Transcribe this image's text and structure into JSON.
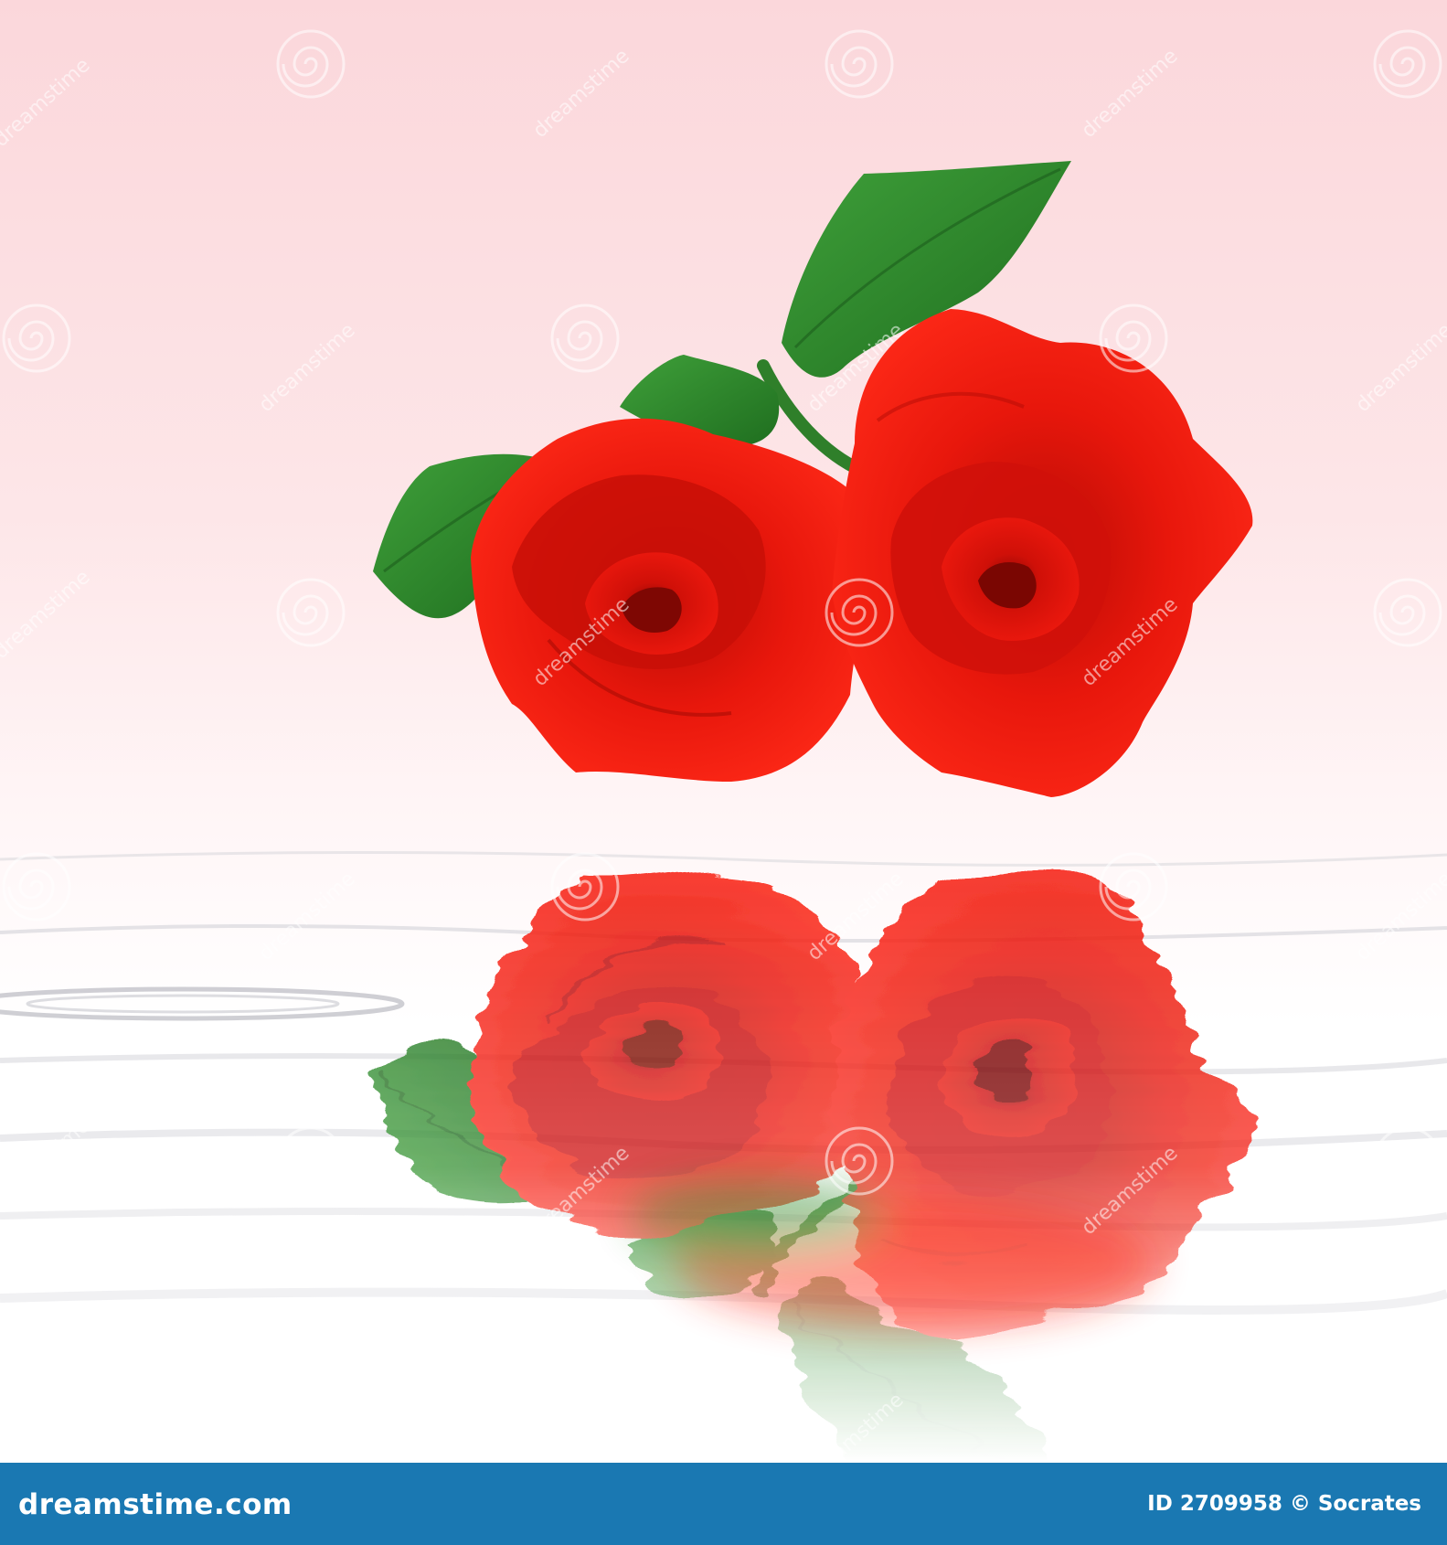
{
  "footer": {
    "brand": "dreamstime.com",
    "credit": "ID 2709958 © Socrates"
  },
  "watermark": {
    "text": "dreamstime",
    "logo_icon": "spiral-logo-icon"
  },
  "palette": {
    "sky_top": "#fbd9dc",
    "sky_bottom": "#ffffff",
    "rose_red": "#e4120a",
    "rose_dark": "#a70b06",
    "leaf_green": "#2e8b2a",
    "footer_blue": "#1a78b2"
  }
}
